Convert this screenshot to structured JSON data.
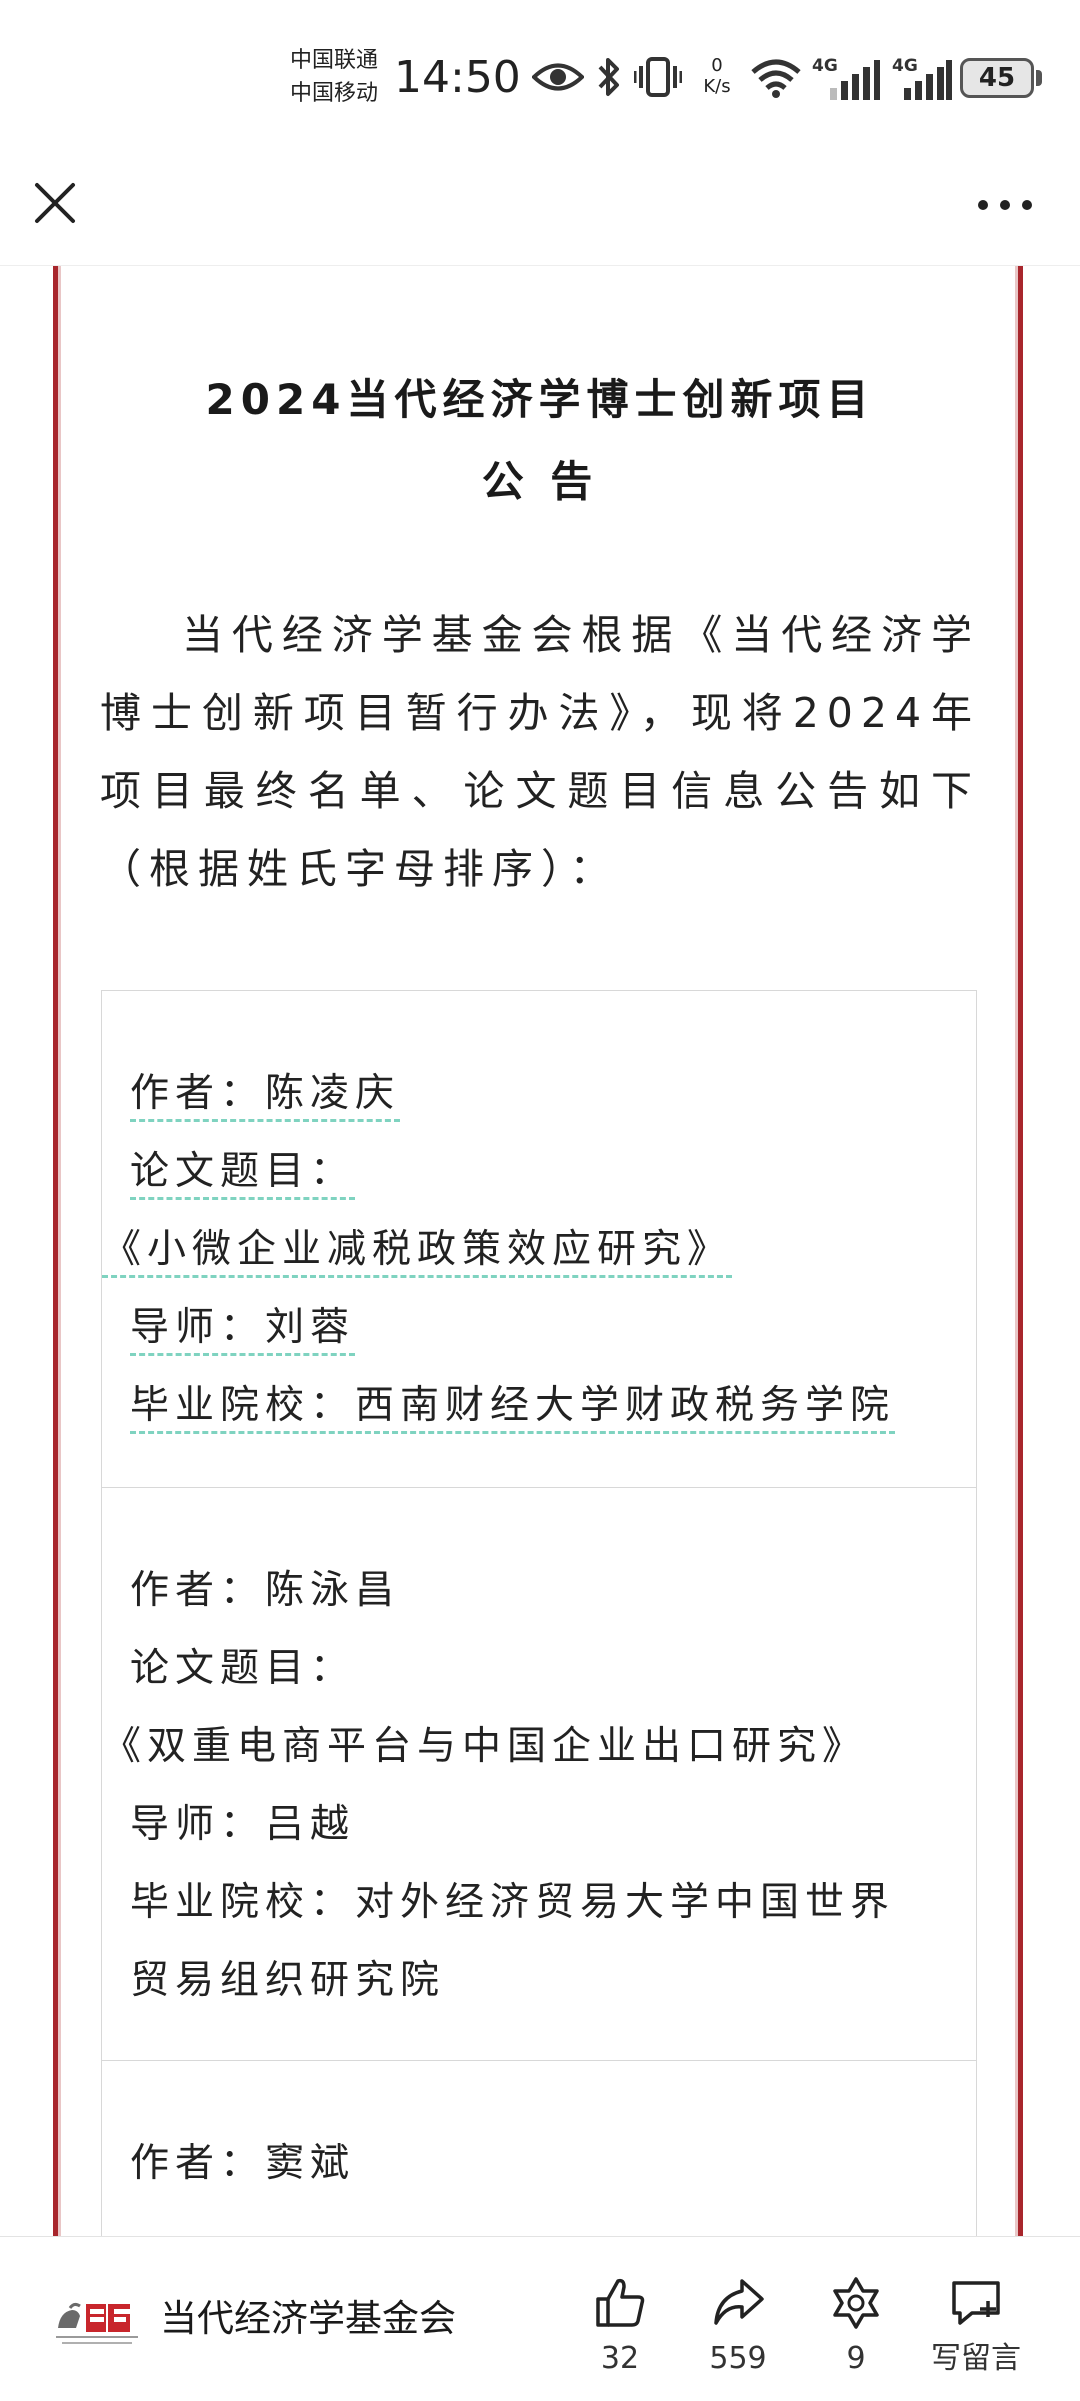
{
  "status_bar": {
    "carrier_1": "中国联通",
    "carrier_2": "中国移动",
    "time": "14:50",
    "net_speed_value": "0",
    "net_speed_unit": "K/s",
    "signal_1_label": "4G",
    "signal_2_label": "4G",
    "battery": "45",
    "icons": [
      "eye-icon",
      "bluetooth-icon",
      "vibrate-icon",
      "wifi-icon",
      "signal-icon",
      "battery-icon"
    ]
  },
  "nav": {
    "close_icon": "close-icon",
    "more_icon": "more-icon"
  },
  "article": {
    "title_line_1": "2024当代经济学博士创新项目",
    "title_line_2": "公 告",
    "intro": "当代经济学基金会根据《当代经济学博士创新项目暂行办法》，现将2024年项目最终名单、论文题目信息公告如下（根据姓氏字母排序）：",
    "accent_color": "#a8262c",
    "underline_color": "#7fd3c0",
    "records": [
      {
        "author": "作者：陈凌庆",
        "title_label": "论文题目：",
        "title": "《小微企业减税政策效应研究》",
        "advisor": "导师：刘蓉",
        "school_1": "毕业院校：西南财经大学财政税务学院",
        "school_2": ""
      },
      {
        "author": "作者：陈泳昌",
        "title_label": "论文题目：",
        "title": "《双重电商平台与中国企业出口研究》",
        "advisor": "导师：吕越",
        "school_1": "毕业院校：对外经济贸易大学中国世界",
        "school_2": "贸易组织研究院"
      },
      {
        "author": "作者：窦斌"
      }
    ]
  },
  "bottom_bar": {
    "account_name": "当代经济学基金会",
    "like_count": "32",
    "share_count": "559",
    "favorite_count": "9",
    "comment_label": "写留言"
  }
}
